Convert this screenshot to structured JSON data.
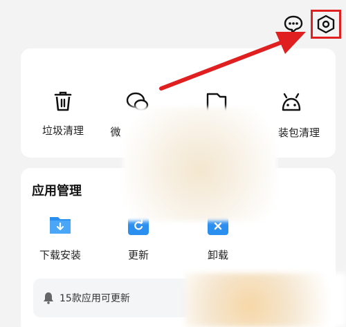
{
  "header": {
    "chat_icon": "chat-bubble-icon",
    "settings_icon": "hexagon-settings-icon",
    "annotation_color": "#e02020"
  },
  "clean_tools": [
    {
      "label": "垃圾清理",
      "icon": "trash-icon"
    },
    {
      "label": "微",
      "icon": "chat-bubbles-icon"
    },
    {
      "label": "",
      "icon": "folder-icon"
    },
    {
      "label": "装包清理",
      "icon": "android-icon"
    }
  ],
  "app_management": {
    "title": "应用管理",
    "items": [
      {
        "label": "下载安装",
        "icon": "download-folder-icon",
        "color": "#2b8ff0"
      },
      {
        "label": "更新",
        "icon": "update-icon",
        "color": "#2b8ff0"
      },
      {
        "label": "卸载",
        "icon": "uninstall-icon",
        "color": "#2b8ff0"
      }
    ],
    "notice": "15款应用可更新"
  }
}
